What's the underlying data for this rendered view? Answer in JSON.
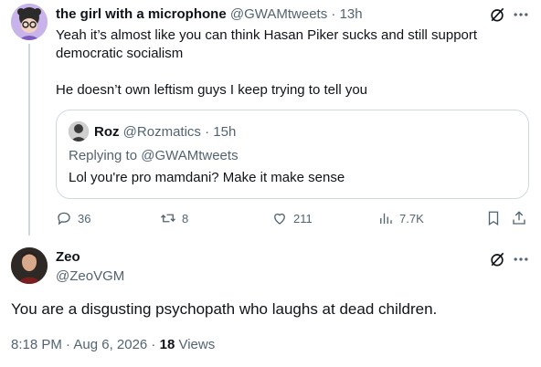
{
  "reply_tweet": {
    "display_name": "the girl with a microphone",
    "handle": "@GWAMtweets",
    "separator": "·",
    "time": "13h",
    "lines": [
      "Yeah it’s almost like you can think Hasan Piker sucks and still support democratic socialism",
      "He doesn’t own leftism guys I keep trying to tell you"
    ],
    "quote": {
      "display_name": "Roz",
      "handle": "@Rozmatics",
      "separator": "·",
      "time": "15h",
      "replying_to_prefix": "Replying to",
      "replying_to_handle": "@GWAMtweets",
      "text": "Lol you're pro mamdani? Make it make sense"
    },
    "metrics": {
      "replies": "36",
      "reposts": "8",
      "likes": "211",
      "views": "7.7K"
    }
  },
  "main_tweet": {
    "display_name": "Zeo",
    "handle": "@ZeoVGM",
    "text": "You are a disgusting psychopath who laughs at dead children.",
    "timestamp": "8:18 PM · Aug 6, 2026 ·",
    "views_count": "18",
    "views_label": "Views"
  },
  "colors": {
    "text": "#0f1419",
    "muted": "#536471",
    "border": "#cfd9de"
  },
  "icons": [
    "reply-icon",
    "repost-icon",
    "like-icon",
    "views-icon",
    "bookmark-icon",
    "share-icon",
    "grok-icon",
    "more-icon"
  ]
}
